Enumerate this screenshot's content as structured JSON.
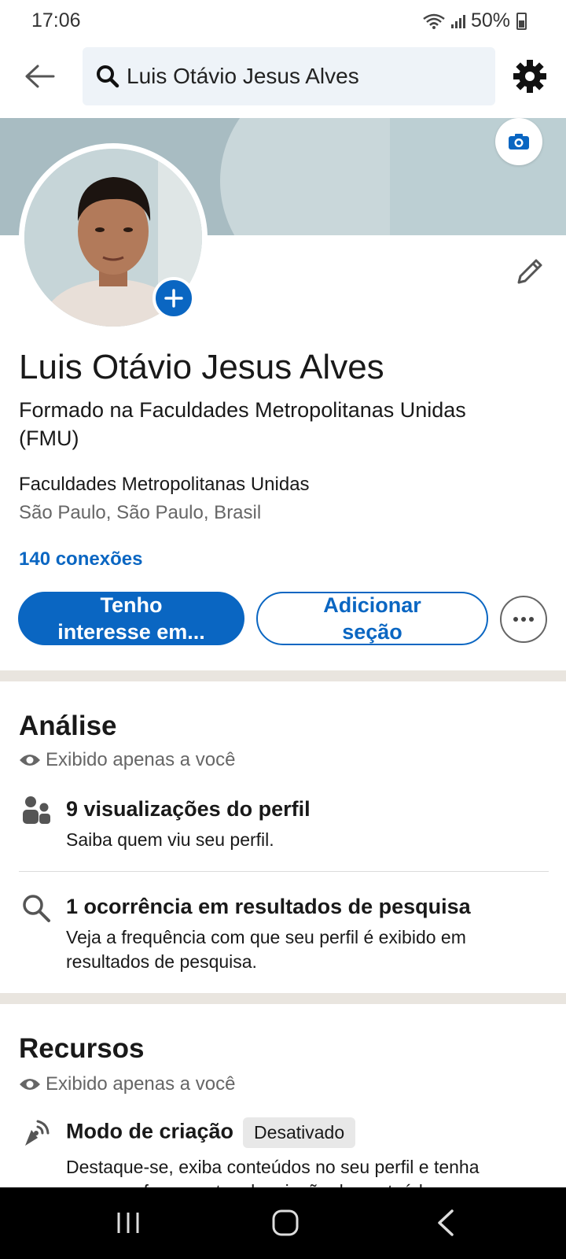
{
  "status_bar": {
    "time": "17:06",
    "battery": "50%"
  },
  "search": {
    "query": "Luis Otávio Jesus Alves"
  },
  "profile": {
    "name": "Luis Otávio Jesus Alves",
    "headline": "Formado na Faculdades Metropolitanas Unidas (FMU)",
    "school": "Faculdades Metropolitanas Unidas",
    "location": "São Paulo, São Paulo, Brasil",
    "connections": "140 conexões"
  },
  "actions": {
    "primary_line1": "Tenho",
    "primary_line2": "interesse em...",
    "secondary_line1": "Adicionar",
    "secondary_line2": "seção"
  },
  "analytics": {
    "title": "Análise",
    "visibility": "Exibido apenas a você",
    "items": [
      {
        "title": "9 visualizações do perfil",
        "subtitle": "Saiba quem viu seu perfil.",
        "icon": "people-icon"
      },
      {
        "title": "1 ocorrência em resultados de pesquisa",
        "subtitle": "Veja a frequência com que seu perfil é exibido em resultados de pesquisa.",
        "icon": "search-icon"
      }
    ]
  },
  "resources": {
    "title": "Recursos",
    "visibility": "Exibido apenas a você",
    "items": [
      {
        "title": "Modo de criação",
        "badge": "Desativado",
        "subtitle": "Destaque-se, exiba conteúdos no seu perfil e tenha acesso a ferramentas de criação de conteúdo",
        "icon": "broadcast-icon"
      }
    ]
  },
  "colors": {
    "accent": "#0a66c2",
    "banner": "#a8bcc2",
    "divider": "#e9e5df"
  }
}
